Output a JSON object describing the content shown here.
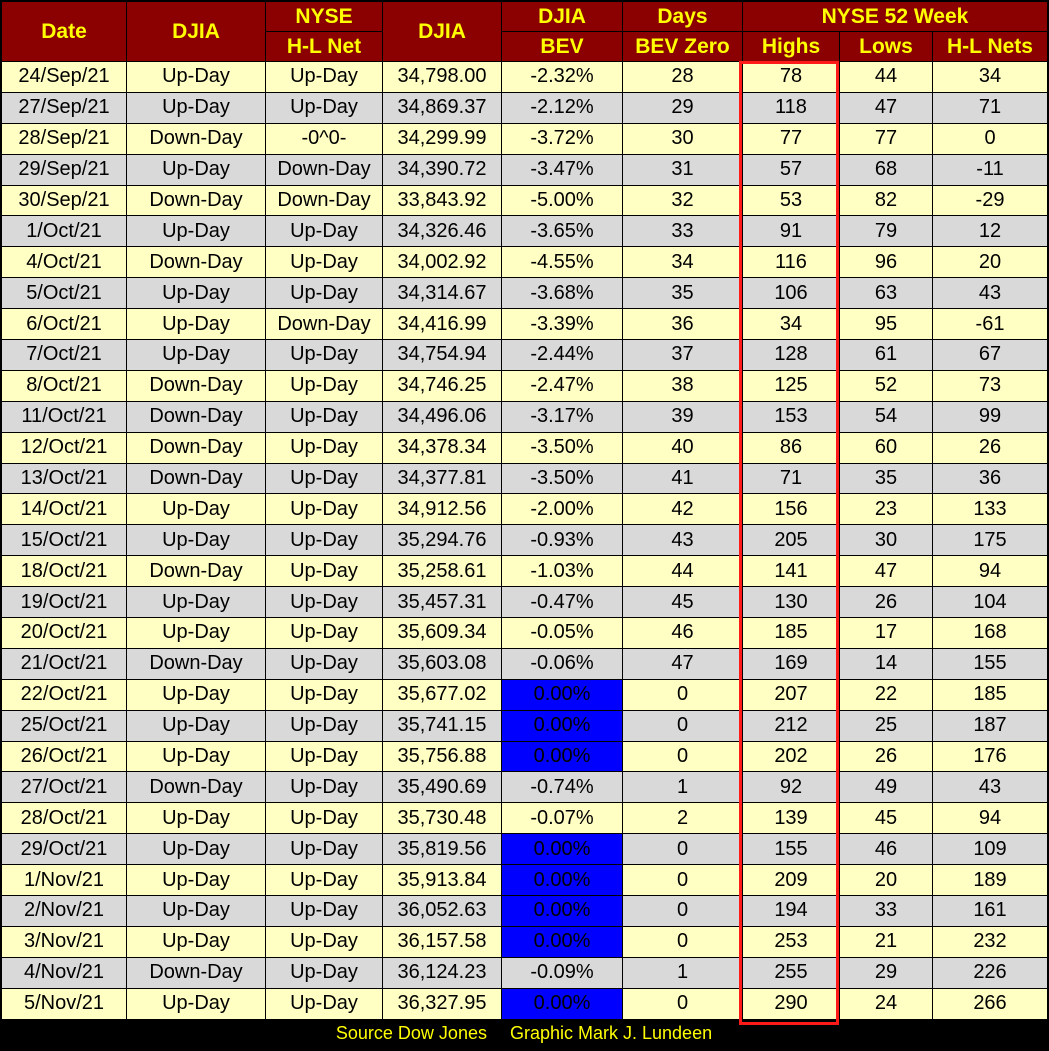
{
  "headers": {
    "date": "Date",
    "djia": "DJIA",
    "nyse_hl_top": "NYSE",
    "nyse_hl_bottom": "H-L Net",
    "djia_close": "DJIA",
    "bev_top": "DJIA",
    "bev_bottom": "BEV",
    "days_top": "Days",
    "days_bottom": "BEV Zero",
    "group_52week": "NYSE 52 Week",
    "highs": "Highs",
    "lows": "Lows",
    "hl_nets": "H-L Nets"
  },
  "colors": {
    "header_bg": "#8b0000",
    "header_text": "#ffff00",
    "row_light": "#ffffc4",
    "row_dark": "#d9d9d9",
    "bev_zero_bg": "#0000ff",
    "highs_highlight": "#ff1a1a"
  },
  "chart_data": {
    "type": "table",
    "columns": [
      "Date",
      "DJIA",
      "NYSE H-L Net",
      "DJIA",
      "DJIA BEV",
      "Days BEV Zero",
      "NYSE 52 Week Highs",
      "NYSE 52 Week Lows",
      "NYSE 52 Week H-L Nets"
    ],
    "rows": [
      [
        "24/Sep/21",
        "Up-Day",
        "Up-Day",
        "34,798.00",
        "-2.32%",
        "28",
        "78",
        "44",
        "34"
      ],
      [
        "27/Sep/21",
        "Up-Day",
        "Up-Day",
        "34,869.37",
        "-2.12%",
        "29",
        "118",
        "47",
        "71"
      ],
      [
        "28/Sep/21",
        "Down-Day",
        "-0^0-",
        "34,299.99",
        "-3.72%",
        "30",
        "77",
        "77",
        "0"
      ],
      [
        "29/Sep/21",
        "Up-Day",
        "Down-Day",
        "34,390.72",
        "-3.47%",
        "31",
        "57",
        "68",
        "-11"
      ],
      [
        "30/Sep/21",
        "Down-Day",
        "Down-Day",
        "33,843.92",
        "-5.00%",
        "32",
        "53",
        "82",
        "-29"
      ],
      [
        "1/Oct/21",
        "Up-Day",
        "Up-Day",
        "34,326.46",
        "-3.65%",
        "33",
        "91",
        "79",
        "12"
      ],
      [
        "4/Oct/21",
        "Down-Day",
        "Up-Day",
        "34,002.92",
        "-4.55%",
        "34",
        "116",
        "96",
        "20"
      ],
      [
        "5/Oct/21",
        "Up-Day",
        "Up-Day",
        "34,314.67",
        "-3.68%",
        "35",
        "106",
        "63",
        "43"
      ],
      [
        "6/Oct/21",
        "Up-Day",
        "Down-Day",
        "34,416.99",
        "-3.39%",
        "36",
        "34",
        "95",
        "-61"
      ],
      [
        "7/Oct/21",
        "Up-Day",
        "Up-Day",
        "34,754.94",
        "-2.44%",
        "37",
        "128",
        "61",
        "67"
      ],
      [
        "8/Oct/21",
        "Down-Day",
        "Up-Day",
        "34,746.25",
        "-2.47%",
        "38",
        "125",
        "52",
        "73"
      ],
      [
        "11/Oct/21",
        "Down-Day",
        "Up-Day",
        "34,496.06",
        "-3.17%",
        "39",
        "153",
        "54",
        "99"
      ],
      [
        "12/Oct/21",
        "Down-Day",
        "Up-Day",
        "34,378.34",
        "-3.50%",
        "40",
        "86",
        "60",
        "26"
      ],
      [
        "13/Oct/21",
        "Down-Day",
        "Up-Day",
        "34,377.81",
        "-3.50%",
        "41",
        "71",
        "35",
        "36"
      ],
      [
        "14/Oct/21",
        "Up-Day",
        "Up-Day",
        "34,912.56",
        "-2.00%",
        "42",
        "156",
        "23",
        "133"
      ],
      [
        "15/Oct/21",
        "Up-Day",
        "Up-Day",
        "35,294.76",
        "-0.93%",
        "43",
        "205",
        "30",
        "175"
      ],
      [
        "18/Oct/21",
        "Down-Day",
        "Up-Day",
        "35,258.61",
        "-1.03%",
        "44",
        "141",
        "47",
        "94"
      ],
      [
        "19/Oct/21",
        "Up-Day",
        "Up-Day",
        "35,457.31",
        "-0.47%",
        "45",
        "130",
        "26",
        "104"
      ],
      [
        "20/Oct/21",
        "Up-Day",
        "Up-Day",
        "35,609.34",
        "-0.05%",
        "46",
        "185",
        "17",
        "168"
      ],
      [
        "21/Oct/21",
        "Down-Day",
        "Up-Day",
        "35,603.08",
        "-0.06%",
        "47",
        "169",
        "14",
        "155"
      ],
      [
        "22/Oct/21",
        "Up-Day",
        "Up-Day",
        "35,677.02",
        "0.00%",
        "0",
        "207",
        "22",
        "185"
      ],
      [
        "25/Oct/21",
        "Up-Day",
        "Up-Day",
        "35,741.15",
        "0.00%",
        "0",
        "212",
        "25",
        "187"
      ],
      [
        "26/Oct/21",
        "Up-Day",
        "Up-Day",
        "35,756.88",
        "0.00%",
        "0",
        "202",
        "26",
        "176"
      ],
      [
        "27/Oct/21",
        "Down-Day",
        "Up-Day",
        "35,490.69",
        "-0.74%",
        "1",
        "92",
        "49",
        "43"
      ],
      [
        "28/Oct/21",
        "Up-Day",
        "Up-Day",
        "35,730.48",
        "-0.07%",
        "2",
        "139",
        "45",
        "94"
      ],
      [
        "29/Oct/21",
        "Up-Day",
        "Up-Day",
        "35,819.56",
        "0.00%",
        "0",
        "155",
        "46",
        "109"
      ],
      [
        "1/Nov/21",
        "Up-Day",
        "Up-Day",
        "35,913.84",
        "0.00%",
        "0",
        "209",
        "20",
        "189"
      ],
      [
        "2/Nov/21",
        "Up-Day",
        "Up-Day",
        "36,052.63",
        "0.00%",
        "0",
        "194",
        "33",
        "161"
      ],
      [
        "3/Nov/21",
        "Up-Day",
        "Up-Day",
        "36,157.58",
        "0.00%",
        "0",
        "253",
        "21",
        "232"
      ],
      [
        "4/Nov/21",
        "Down-Day",
        "Up-Day",
        "36,124.23",
        "-0.09%",
        "1",
        "255",
        "29",
        "226"
      ],
      [
        "5/Nov/21",
        "Up-Day",
        "Up-Day",
        "36,327.95",
        "0.00%",
        "0",
        "290",
        "24",
        "266"
      ]
    ],
    "highlighted_column": "NYSE 52 Week Highs"
  },
  "footer": {
    "source": "Source Dow Jones",
    "credit": "Graphic Mark J. Lundeen"
  }
}
